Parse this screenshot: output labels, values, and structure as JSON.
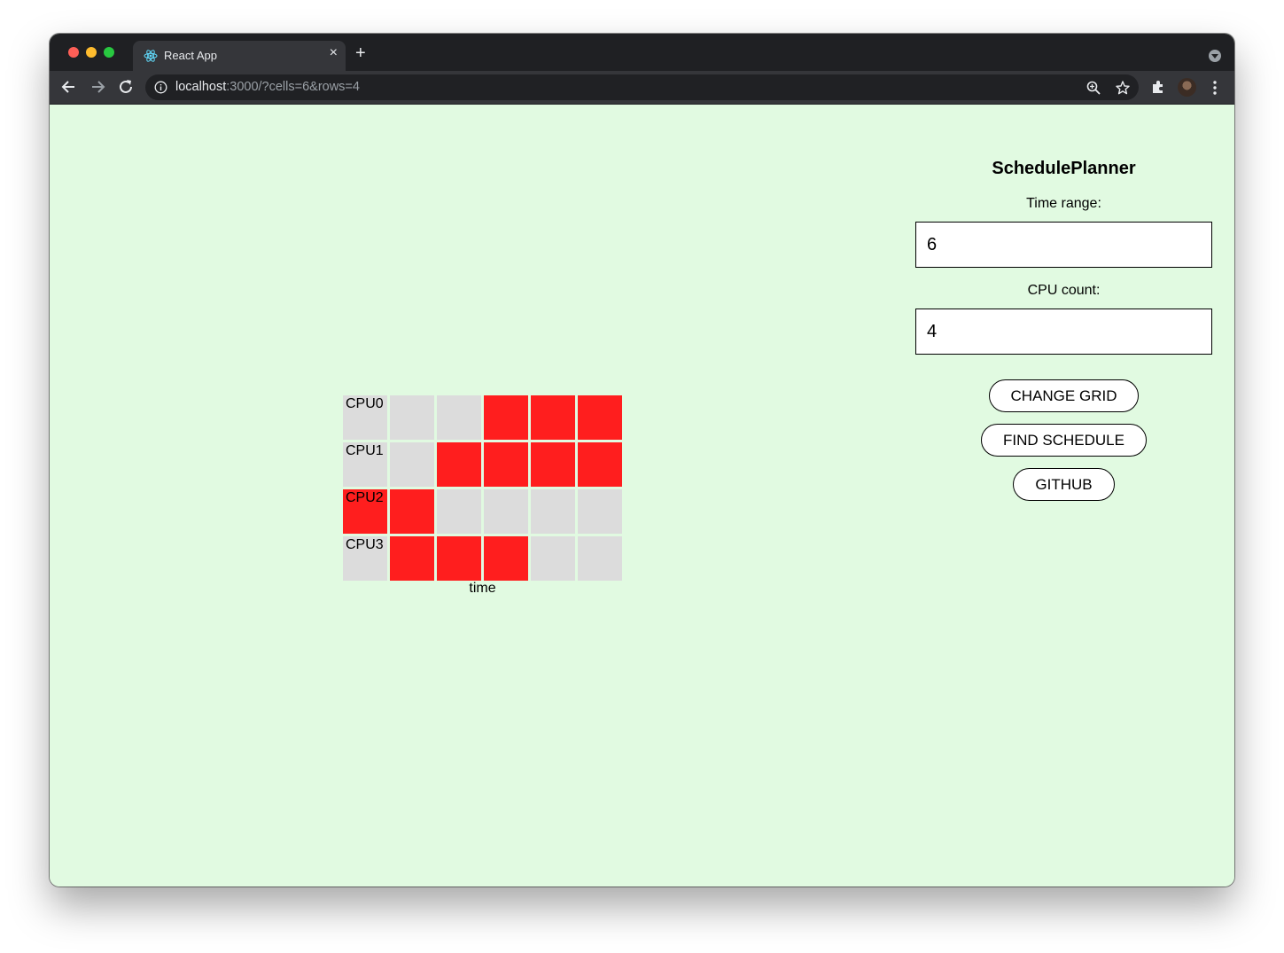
{
  "browser": {
    "tab_title": "React App",
    "url_host": "localhost",
    "url_rest": ":3000/?cells=6&rows=4",
    "new_tab_label": "+",
    "close_tab_label": "×"
  },
  "grid": {
    "rows": [
      {
        "label": "CPU0",
        "label_active": false,
        "cells": [
          false,
          false,
          true,
          true,
          true
        ]
      },
      {
        "label": "CPU1",
        "label_active": false,
        "cells": [
          false,
          true,
          true,
          true,
          true
        ]
      },
      {
        "label": "CPU2",
        "label_active": true,
        "cells": [
          true,
          false,
          false,
          false,
          false
        ]
      },
      {
        "label": "CPU3",
        "label_active": false,
        "cells": [
          true,
          true,
          true,
          false,
          false
        ]
      }
    ],
    "axis_label": "time",
    "active_color": "#ff1e1e",
    "inactive_color": "#dcdcdc"
  },
  "panel": {
    "title": "SchedulePlanner",
    "time_range_label": "Time range:",
    "time_range_value": "6",
    "cpu_count_label": "CPU count:",
    "cpu_count_value": "4",
    "change_grid_label": "CHANGE GRID",
    "find_schedule_label": "FIND SCHEDULE",
    "github_label": "GITHUB"
  },
  "colors": {
    "page_background": "#e1fae1"
  }
}
